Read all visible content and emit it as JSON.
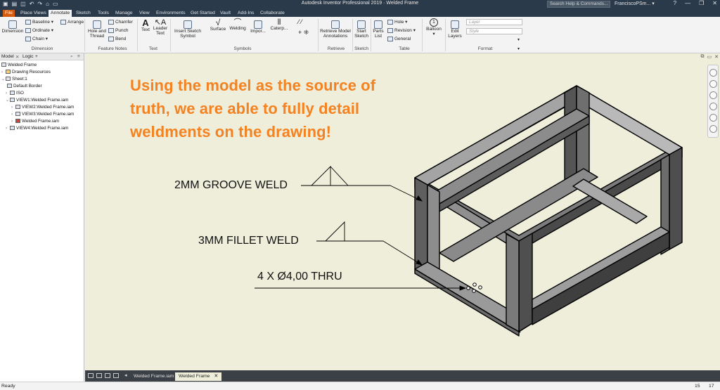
{
  "window": {
    "title": "Autodesk Inventor Professional 2019 · Welded Frame",
    "search_placeholder": "Search Help & Commands...",
    "user": "FranciscoPSm... ▾",
    "help": "?",
    "controls": [
      "—",
      "❐",
      "✕"
    ]
  },
  "ribbon_tabs": [
    "File",
    "Place Views",
    "Annotate",
    "Sketch",
    "Tools",
    "Manage",
    "View",
    "Environments",
    "Get Started",
    "Vault",
    "Add-Ins",
    "Collaborate"
  ],
  "active_tab": "Annotate",
  "ribbon": {
    "dimension": {
      "big": "Dimension",
      "small": [
        "Baseline",
        "Ordinate",
        "Chain"
      ],
      "arrange": "Arrange",
      "group": "Dimension"
    },
    "feature_notes": {
      "big": "Hole and Thread",
      "small": [
        "Chamfer",
        "Punch",
        "Bend"
      ],
      "group": "Feature Notes"
    },
    "text": {
      "items": [
        "Text",
        "Leader Text"
      ],
      "group": "Text"
    },
    "symbols": {
      "items": [
        "Insert Sketch Symbol",
        "Surface",
        "Welding",
        "Impor...",
        "Caterp..."
      ],
      "group": "Symbols"
    },
    "retrieve": {
      "items": [
        "Retrieve Model Annotations"
      ],
      "group": "Retrieve"
    },
    "sketch": {
      "items": [
        "Start Sketch"
      ],
      "group": "Sketch"
    },
    "table": {
      "big": "Parts List",
      "small": [
        "Hole",
        "Revision",
        "General"
      ],
      "group": "Table"
    },
    "balloon": {
      "label": "Balloon"
    },
    "edit_layers": {
      "label": "Edit Layers"
    },
    "format": {
      "layer_placeholder": "Layer",
      "style_placeholder": "Style",
      "group": "Format"
    }
  },
  "browser": {
    "tabs": [
      "Model",
      "Logic",
      "+"
    ],
    "tree": [
      {
        "label": "Welded Frame",
        "level": 0
      },
      {
        "label": "Drawing Resources",
        "level": 1
      },
      {
        "label": "Sheet:1",
        "level": 1
      },
      {
        "label": "Default Border",
        "level": 2
      },
      {
        "label": "ISO",
        "level": 2
      },
      {
        "label": "VIEW1:Welded Frame.iam",
        "level": 2
      },
      {
        "label": "VIEW2:Welded Frame.iam",
        "level": 3
      },
      {
        "label": "VIEW3:Welded Frame.iam",
        "level": 3
      },
      {
        "label": "Welded Frame.iam",
        "level": 3
      },
      {
        "label": "VIEW4:Welded Frame.iam",
        "level": 2
      }
    ]
  },
  "canvas": {
    "message": [
      "Using the model as the source of",
      "truth, we are able to fully detail",
      "weldments on the drawing!"
    ],
    "annotations": {
      "groove": "2MM GROOVE WELD",
      "fillet": "3MM FILLET WELD",
      "holes": "4 X Ø4,00 THRU"
    },
    "message_color": "#f58220"
  },
  "doc_tabs": [
    "Welded Frame.iam",
    "Welded Frame"
  ],
  "active_doc_tab": "Welded Frame",
  "status": {
    "left": "Ready",
    "right": [
      "15",
      "17"
    ]
  }
}
